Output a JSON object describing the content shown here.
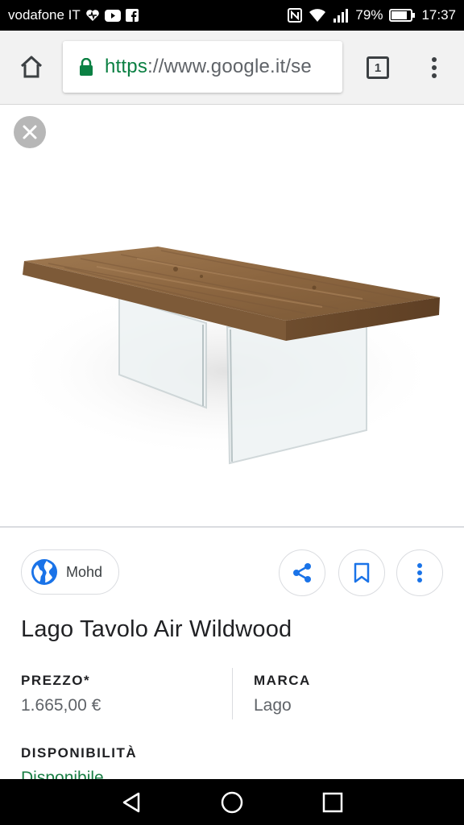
{
  "status_bar": {
    "carrier": "vodafone IT",
    "battery_percent": "79%",
    "time": "17:37",
    "icons": [
      "heart-icon",
      "youtube-icon",
      "facebook-icon",
      "nfc-icon",
      "wifi-icon",
      "signal-icon",
      "battery-icon"
    ]
  },
  "toolbar": {
    "url_scheme": "https",
    "url_rest": "://www.google.it/se",
    "tab_count": "1",
    "icons": [
      "home-icon",
      "lock-icon",
      "tab-switcher-icon",
      "more-vert-icon"
    ]
  },
  "image_viewer": {
    "icons": [
      "close-icon"
    ],
    "image": "wooden-table-glass-legs"
  },
  "info": {
    "source_name": "Mohd",
    "title": "Lago Tavolo Air Wildwood",
    "price_label": "PREZZO*",
    "price_value": "1.665,00 €",
    "brand_label": "MARCA",
    "brand_value": "Lago",
    "availability_label": "DISPONIBILITÀ",
    "availability_value": "Disponibile",
    "icons": [
      "globe-icon",
      "share-icon",
      "bookmark-icon",
      "more-vert-icon"
    ]
  },
  "nav_bar": {
    "icons": [
      "back-icon",
      "home-circle-icon",
      "recents-icon"
    ]
  },
  "colors": {
    "accent_blue": "#1a73e8",
    "secure_green": "#0b8043",
    "availability_green": "#1a7f45"
  }
}
